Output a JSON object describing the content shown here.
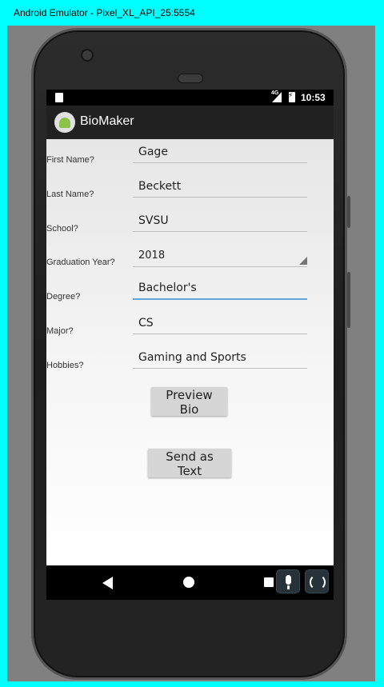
{
  "window": {
    "title": "Android Emulator - Pixel_XL_API_25:5554"
  },
  "status": {
    "network": "4G",
    "time": "10:53"
  },
  "app": {
    "title": "BioMaker"
  },
  "form": {
    "first_name": {
      "label": "First Name?",
      "value": "Gage"
    },
    "last_name": {
      "label": "Last Name?",
      "value": "Beckett"
    },
    "school": {
      "label": "School?",
      "value": "SVSU"
    },
    "graduation_year": {
      "label": "Graduation Year?",
      "value": "2018"
    },
    "degree": {
      "label": "Degree?",
      "value": "Bachelor's"
    },
    "major": {
      "label": "Major?",
      "value": "CS"
    },
    "hobbies": {
      "label": "Hobbies?",
      "value": "Gaming and Sports"
    }
  },
  "buttons": {
    "preview": "Preview Bio",
    "send": "Send as Text"
  },
  "icons": {
    "sd_card": "sd-card-icon",
    "signal": "signal-icon",
    "battery": "battery-charging-icon",
    "back": "back-icon",
    "home": "home-icon",
    "recents": "recents-icon",
    "mic": "microphone-icon",
    "rotate": "rotate-icon"
  },
  "colors": {
    "window_frame": "#00ffff",
    "focus_underline": "#64a4dd",
    "app_bar": "#212121"
  }
}
